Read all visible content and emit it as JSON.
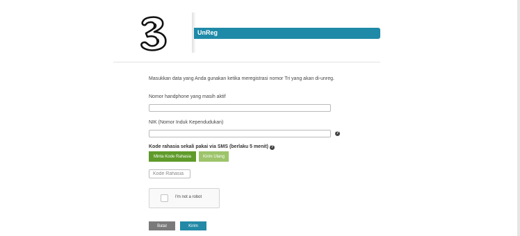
{
  "header": {
    "logo_icon": "three-logo-icon",
    "title": "UnReg",
    "accent": "#1f8aa8"
  },
  "form": {
    "intro": "Masukkan data yang Anda gunakan ketika meregistrasi nomor Tri yang akan di-unreg.",
    "phone": {
      "label": "Nomor handphone yang masih aktif",
      "value": ""
    },
    "nik": {
      "label": "NIK (Nomor Induk Kependudukan)",
      "value": "",
      "help_icon": "question-circle-icon"
    },
    "otp": {
      "label": "Kode rahasia sekali pakai via SMS (berlaku 5 menit)",
      "help_icon": "question-circle-icon",
      "request_button": "Minta Kode Rahasia",
      "resend_button": "Kirim Ulang",
      "code_placeholder": "Kode Rahasia"
    },
    "captcha": {
      "label": "I'm not a robot",
      "checked": false
    },
    "cancel_button": "Batal",
    "submit_button": "Kirim"
  },
  "colors": {
    "primary_green": "#5f9b2a",
    "light_green": "#9dc46a",
    "cancel_gray": "#7a7a7a",
    "submit_teal": "#2389a6"
  }
}
